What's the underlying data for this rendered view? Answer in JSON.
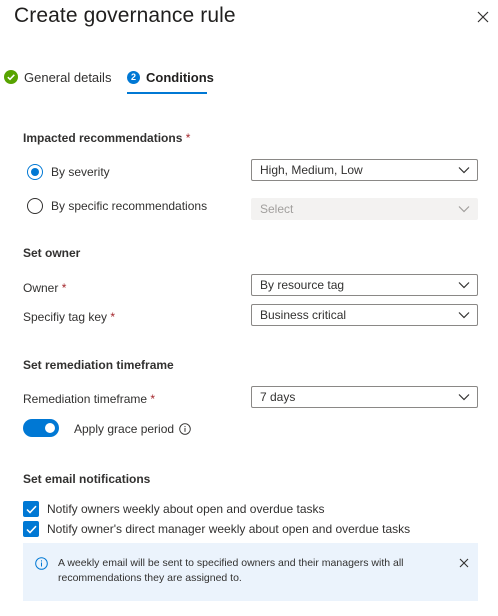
{
  "header": {
    "title": "Create governance rule"
  },
  "tabs": [
    {
      "label": "General details",
      "status": "complete"
    },
    {
      "label": "Conditions",
      "step": "2",
      "active": true
    }
  ],
  "impacted": {
    "heading": "Impacted recommendations",
    "required_mark": "*",
    "options": [
      {
        "label": "By severity",
        "selected": true,
        "dropdown_value": "High, Medium, Low",
        "disabled": false
      },
      {
        "label": "By specific recommendations",
        "selected": false,
        "dropdown_value": "Select",
        "disabled": true
      }
    ]
  },
  "owner": {
    "heading": "Set owner",
    "owner_label": "Owner",
    "owner_value": "By resource tag",
    "tag_label": "Specifiy tag key",
    "tag_value": "Business critical",
    "required_mark": "*"
  },
  "remediation": {
    "heading": "Set remediation timeframe",
    "label": "Remediation timeframe",
    "value": "7 days",
    "required_mark": "*",
    "grace_label": "Apply grace period",
    "grace_enabled": true
  },
  "email": {
    "heading": "Set email notifications",
    "options": [
      {
        "label": "Notify owners weekly about open and overdue tasks",
        "checked": true
      },
      {
        "label": "Notify owner's direct manager weekly about open and overdue tasks",
        "checked": true
      }
    ],
    "banner_text": "A weekly email will be sent to specified owners and their managers with all recommendations they are assigned to."
  },
  "colors": {
    "accent": "#0078d4",
    "success": "#57a300",
    "required": "#a4262c",
    "banner_bg": "#ebf3fc"
  },
  "icons": {
    "close": "close-icon",
    "complete": "check-circle-icon",
    "info": "info-icon",
    "chevron": "chevron-down-icon"
  }
}
